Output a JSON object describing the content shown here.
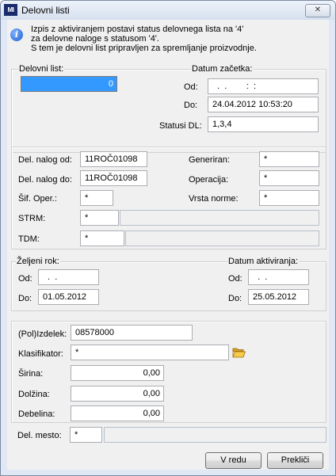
{
  "window": {
    "title": "Delovni listi",
    "icon_text": "MI"
  },
  "info": {
    "icon": "info-icon",
    "lines": [
      "Izpis z aktiviranjem postavi status delovnega lista na '4'",
      "za delovne naloge s statusom '4'.",
      "S tem je delovni list pripravljen za spremljanje proizvodnje."
    ]
  },
  "delovni_list": {
    "legend": "Delovni list:",
    "value": "0"
  },
  "datum_zacetka": {
    "legend": "Datum začetka:",
    "od_label": "Od:",
    "od_value": "  .  .        :  :",
    "do_label": "Do:",
    "do_value": "24.04.2012 10:53:20",
    "statusi_label": "Statusi DL:",
    "statusi_value": "1,3,4"
  },
  "nalog": {
    "del_nalog_od_label": "Del. nalog od:",
    "del_nalog_od_value": "11ROČ01098",
    "del_nalog_do_label": "Del. nalog do:",
    "del_nalog_do_value": "11ROČ01098",
    "sif_oper_label": "Šif. Oper.:",
    "sif_oper_value": "*",
    "strm_label": "STRM:",
    "strm_value": "*",
    "tdm_label": "TDM:",
    "tdm_value": "*",
    "generiran_label": "Generiran:",
    "generiran_value": "*",
    "operacija_label": "Operacija:",
    "operacija_value": "*",
    "vrsta_norme_label": "Vrsta norme:",
    "vrsta_norme_value": "*"
  },
  "zeljeni_rok": {
    "legend": "Željeni rok:",
    "od_label": "Od:",
    "od_value": "  .  .",
    "do_label": "Do:",
    "do_value": "01.05.2012"
  },
  "datum_aktiviranja": {
    "legend": "Datum aktiviranja:",
    "od_label": "Od:",
    "od_value": "  .  .",
    "do_label": "Do:",
    "do_value": "25.05.2012"
  },
  "izdelek": {
    "izdelek_label": "(Pol)Izdelek:",
    "izdelek_value": "08578000",
    "klasifikator_label": "Klasifikator:",
    "klasifikator_value": "*",
    "folder_icon": "folder-open-icon",
    "sirina_label": "Širina:",
    "sirina_value": "0,00",
    "dolzina_label": "Dolžina:",
    "dolzina_value": "0,00",
    "debelina_label": "Debelina:",
    "debelina_value": "0,00"
  },
  "del_mesto": {
    "label": "Del. mesto:",
    "value": "*"
  },
  "buttons": {
    "ok": "V redu",
    "cancel": "Prekliči"
  },
  "colors": {
    "titlebar": "#d5e0ef",
    "client": "#f0f0f0",
    "selection": "#3399ff"
  }
}
